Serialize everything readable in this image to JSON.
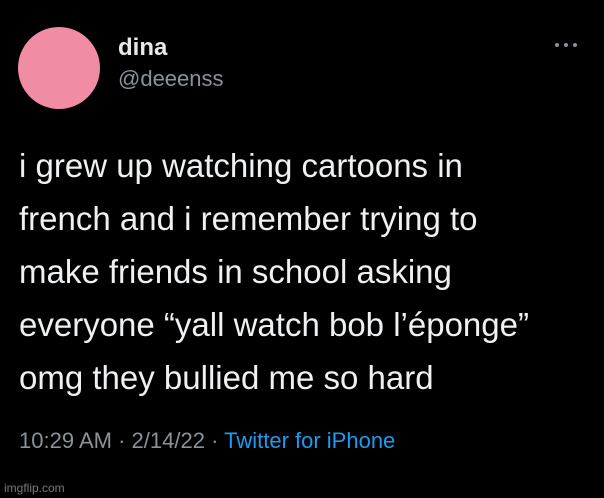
{
  "tweet": {
    "display_name": "dina",
    "handle": "@deeenss",
    "avatar_color": "#f08ca4",
    "text_lines": [
      "i grew up watching cartoons in",
      "french and i remember trying to",
      "make friends in school asking",
      "everyone “yall watch bob l’éponge”",
      "omg they bullied me so hard"
    ],
    "time": "10:29 AM",
    "separator": "·",
    "date": "2/14/22",
    "source": "Twitter for iPhone",
    "more_icon": "more-horizontal-icon"
  },
  "watermark": "imgflip.com",
  "colors": {
    "background": "#000000",
    "text": "#e7e9ea",
    "secondary": "#8b9299",
    "link": "#1d9bf0"
  }
}
